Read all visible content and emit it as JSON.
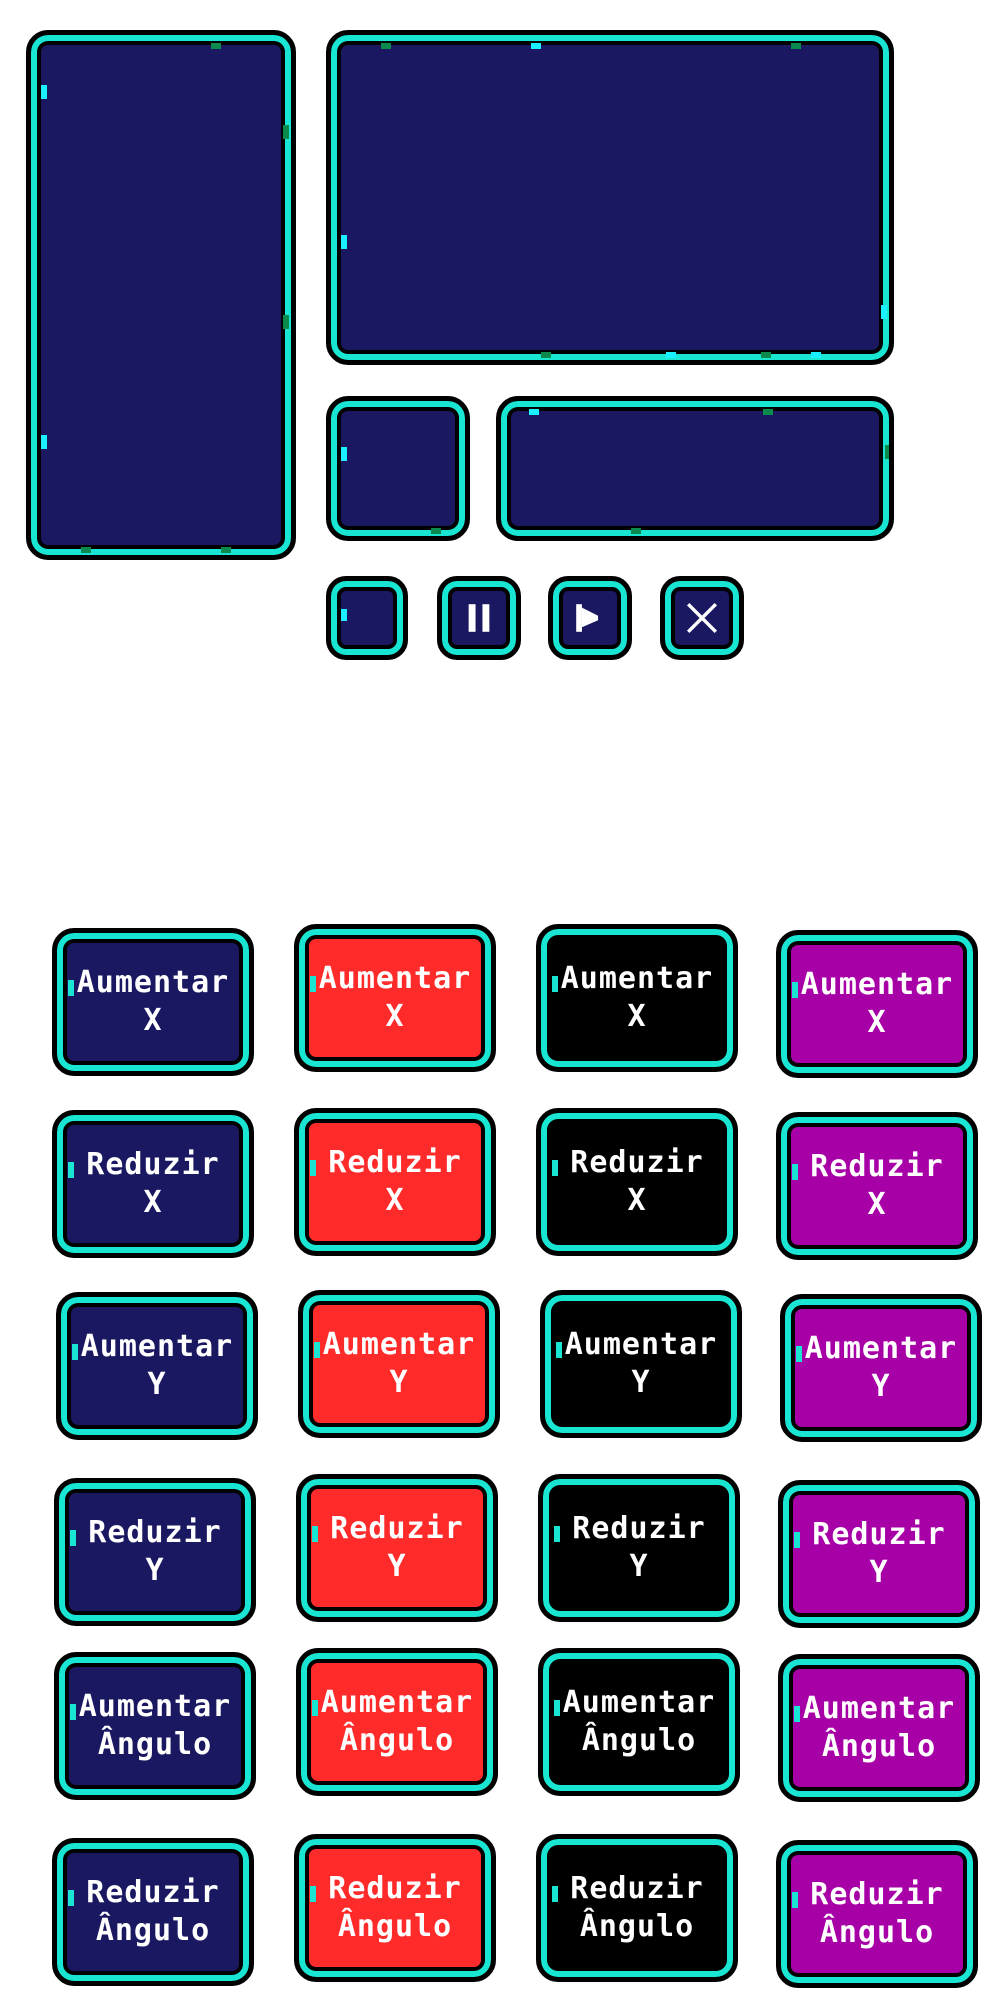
{
  "palette": {
    "navy": "#1b1862",
    "red": "#ff2b2b",
    "black": "#000000",
    "purple": "#a600a6",
    "border_cyan": "#19e6d2",
    "speck_green": "#0a8a4c"
  },
  "panels": [
    {
      "name": "panel-tall-left",
      "color": "navy"
    },
    {
      "name": "panel-wide-top",
      "color": "navy"
    },
    {
      "name": "panel-small-square",
      "color": "navy"
    },
    {
      "name": "panel-wide-bottom",
      "color": "navy"
    }
  ],
  "controls": [
    {
      "name": "blank-button",
      "icon": "none"
    },
    {
      "name": "pause-button",
      "icon": "pause-icon"
    },
    {
      "name": "play-button",
      "icon": "play-flag-icon"
    },
    {
      "name": "close-button",
      "icon": "close-icon"
    }
  ],
  "button_colors": [
    "navy",
    "red",
    "black",
    "purple"
  ],
  "button_rows": [
    {
      "line1": "Aumentar",
      "line2": "X"
    },
    {
      "line1": "Reduzir",
      "line2": "X"
    },
    {
      "line1": "Aumentar",
      "line2": "Y"
    },
    {
      "line1": "Reduzir",
      "line2": "Y"
    },
    {
      "line1": "Aumentar",
      "line2": "Ângulo"
    },
    {
      "line1": "Reduzir",
      "line2": "Ângulo"
    }
  ]
}
